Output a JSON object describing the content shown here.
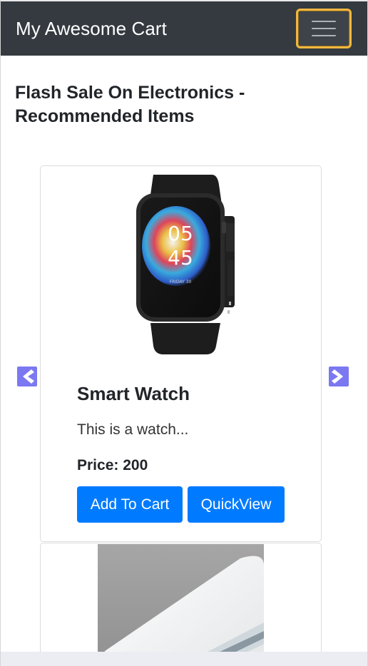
{
  "navbar": {
    "brand": "My Awesome Cart",
    "toggler_icon": "hamburger-menu-icon"
  },
  "section": {
    "heading": "Flash Sale On Electronics - Recommended Items"
  },
  "carousel": {
    "prev_icon": "chevron-left-icon",
    "next_icon": "chevron-right-icon",
    "arrow_color": "#7b78f2",
    "items": [
      {
        "image": "smart-watch-image",
        "watch_time_hour": "05",
        "watch_time_min": "45",
        "watch_date": "FRIDAY 30",
        "title": "Smart Watch",
        "description": "This is a watch...",
        "price_label": "Price:",
        "price_value": "200",
        "add_to_cart": "Add To Cart",
        "quick_view": "QuickView"
      },
      {
        "image": "air-conditioner-image"
      }
    ]
  },
  "colors": {
    "navbar_bg": "#343a40",
    "button_primary": "#007bff",
    "toggler_focus": "#f0b73f"
  }
}
